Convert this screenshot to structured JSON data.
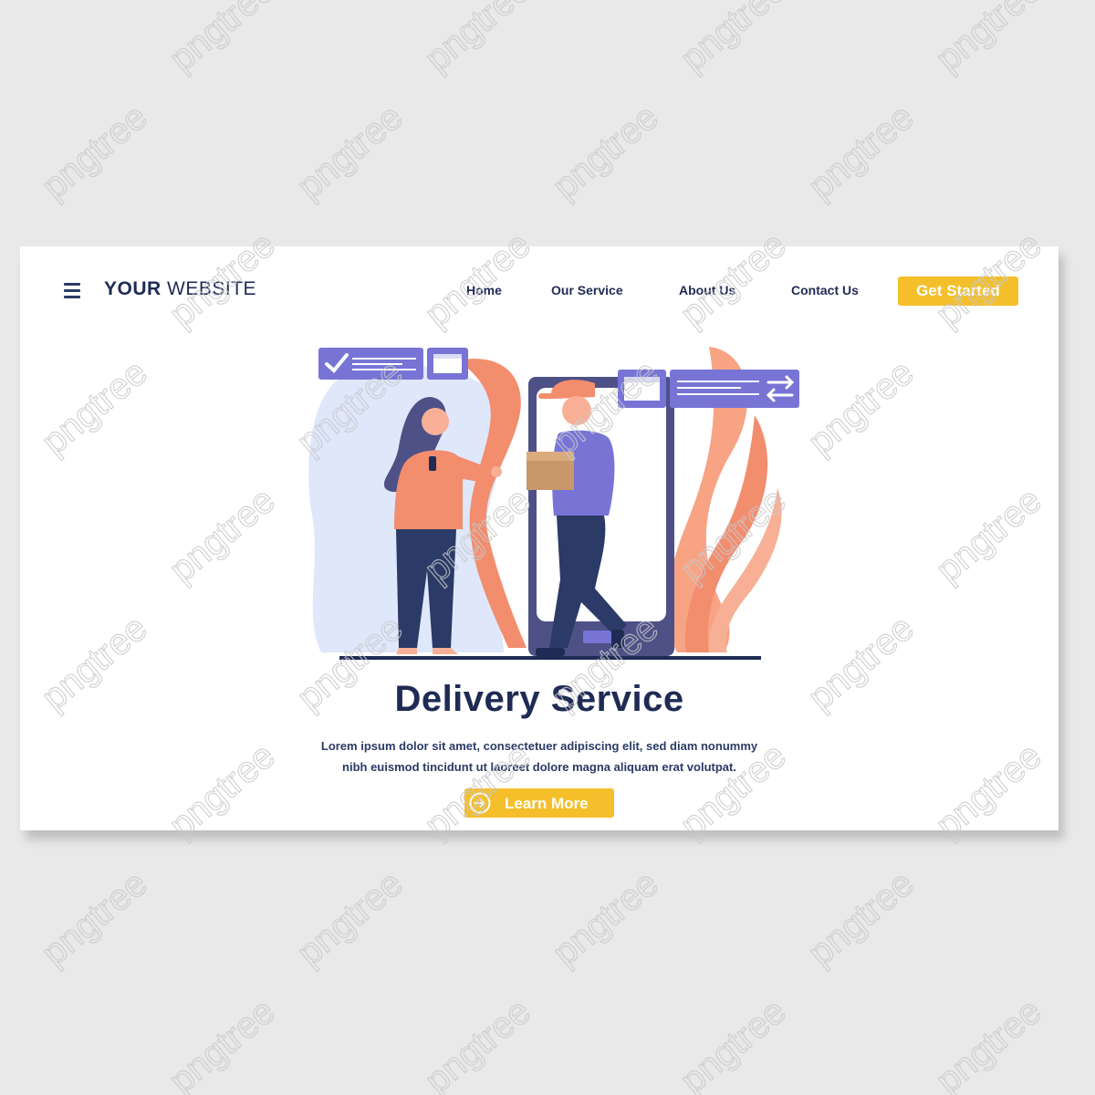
{
  "header": {
    "brand_bold": "YOUR",
    "brand_regular": "WEBSITE",
    "nav": [
      {
        "label": "Home"
      },
      {
        "label": "Our Service"
      },
      {
        "label": "About Us"
      },
      {
        "label": "Contact Us"
      }
    ],
    "cta_label": "Get Started"
  },
  "hero": {
    "title": "Delivery Service",
    "description_line1": "Lorem ipsum dolor sit amet, consectetuer adipiscing elit, sed diam nonummy",
    "description_line2": "nibh euismod tincidunt ut laoreet dolore magna aliquam erat volutpat.",
    "button_label": "Learn More",
    "button_icon": "arrow-right-circle-icon"
  },
  "watermark": "pngtree",
  "colors": {
    "background": "#e9e9ea",
    "navy": "#1f2b55",
    "accent_yellow": "#f4bf2a",
    "purple": "#7774d6",
    "salmon": "#f28d6e",
    "light_blue": "#dfe7fb"
  }
}
